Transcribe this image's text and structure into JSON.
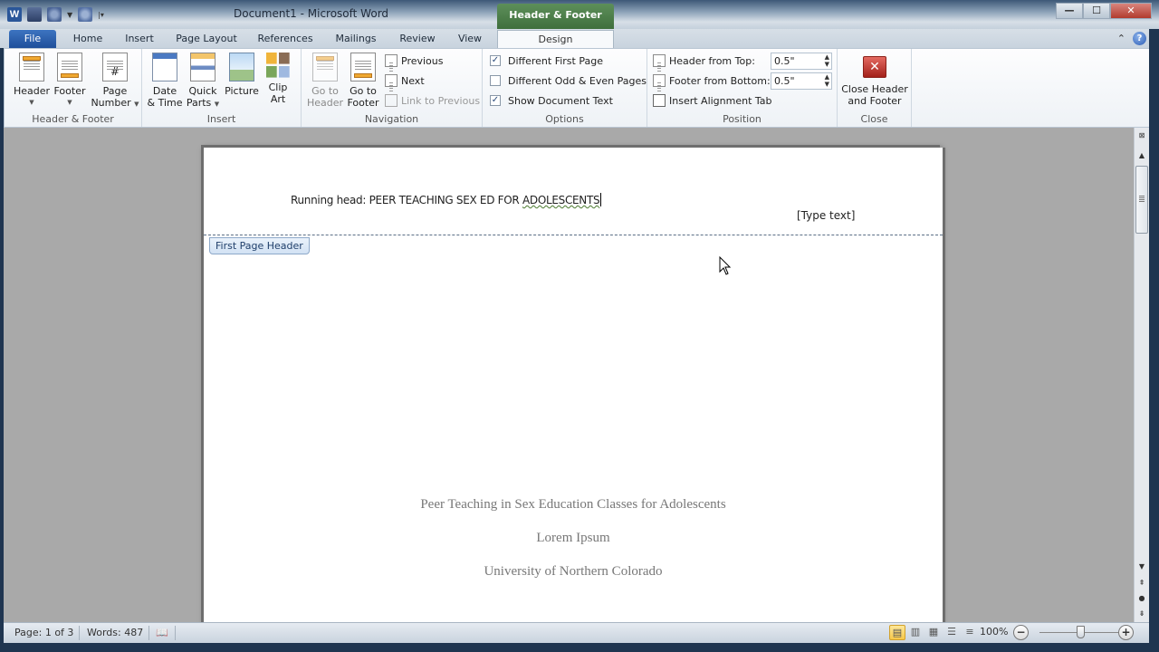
{
  "window": {
    "title": "Document1  -  Microsoft Word",
    "controls": {
      "minimize": "—",
      "maximize": "☐",
      "close": "✕"
    }
  },
  "quick_access": {
    "app_icon": "W",
    "items": [
      "word-icon",
      "save-icon",
      "undo-icon",
      "redo-icon",
      "customize-qat-icon"
    ]
  },
  "contextual_tab": {
    "group_label": "Header & Footer Tools",
    "tab_label": "Design"
  },
  "tabs": [
    {
      "label": "File"
    },
    {
      "label": "Home"
    },
    {
      "label": "Insert"
    },
    {
      "label": "Page Layout"
    },
    {
      "label": "References"
    },
    {
      "label": "Mailings"
    },
    {
      "label": "Review"
    },
    {
      "label": "View"
    }
  ],
  "ribbon": {
    "header_footer": {
      "label": "Header & Footer",
      "header": "Header",
      "footer": "Footer",
      "page_number_1": "Page",
      "page_number_2": "Number"
    },
    "insert": {
      "label": "Insert",
      "date_1": "Date",
      "date_2": "& Time",
      "quick_1": "Quick",
      "quick_2": "Parts",
      "picture": "Picture",
      "clip_1": "Clip",
      "clip_2": "Art"
    },
    "navigation": {
      "label": "Navigation",
      "goto_header_1": "Go to",
      "goto_header_2": "Header",
      "goto_footer_1": "Go to",
      "goto_footer_2": "Footer",
      "previous": "Previous",
      "next": "Next",
      "link_previous": "Link to Previous"
    },
    "options": {
      "label": "Options",
      "items": [
        {
          "label": "Different First Page",
          "checked": true
        },
        {
          "label": "Different Odd & Even Pages",
          "checked": false
        },
        {
          "label": "Show Document Text",
          "checked": true
        }
      ]
    },
    "position": {
      "label": "Position",
      "header_from_top_label": "Header from Top:",
      "header_from_top_value": "0.5\"",
      "footer_from_bottom_label": "Footer from Bottom:",
      "footer_from_bottom_value": "0.5\"",
      "insert_alignment_tab": "Insert Alignment Tab"
    },
    "close": {
      "label": "Close",
      "close_1": "Close Header",
      "close_2": "and Footer"
    }
  },
  "document": {
    "running_head_prefix": "Running head: PEER TEACHING SEX ED FOR ",
    "running_head_flagged": "ADOLESCENTS",
    "type_text_placeholder": "[Type text]",
    "header_area_label": "First Page Header",
    "title": "Peer Teaching  in Sex Education Classes for Adolescents",
    "author": "Lorem Ipsum",
    "institution": "University of Northern Colorado"
  },
  "status_bar": {
    "page": "Page: 1 of 3",
    "words": "Words: 487",
    "zoom": "100%",
    "zoom_percent": 100,
    "active_view": "Print Layout"
  }
}
